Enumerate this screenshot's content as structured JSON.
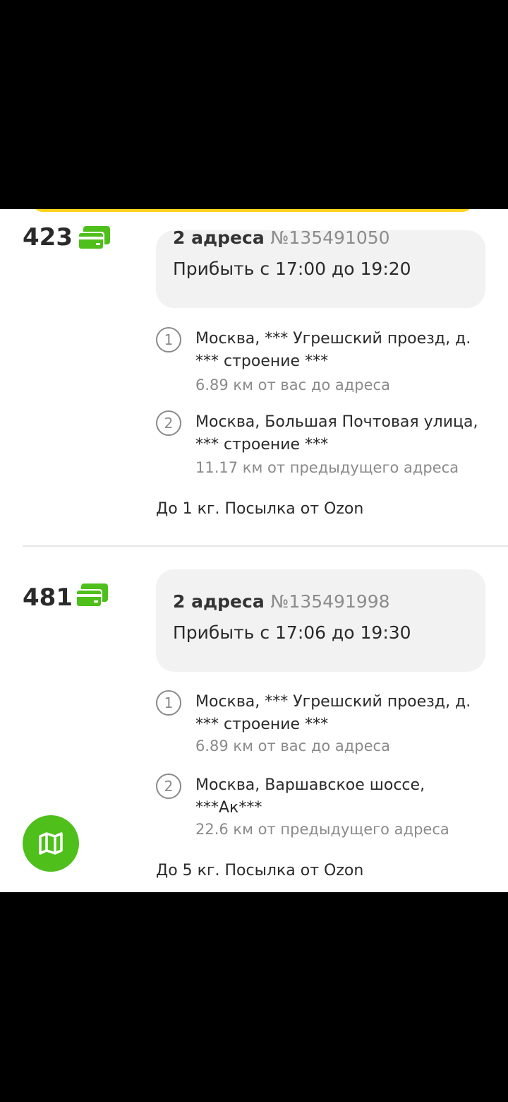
{
  "orders": [
    {
      "price": "423",
      "payment_icon": "card-icon",
      "title": "2 адреса",
      "number": "№135491050",
      "arrival": "Прибыть с 17:00 до 19:20",
      "addresses": [
        {
          "index": "1",
          "text": "Москва, *** Угрешский проезд, д. *** строение ***",
          "distance": "6.89 км от вас до адреса"
        },
        {
          "index": "2",
          "text": "Москва, Большая Почтовая улица, *** строение ***",
          "distance": "11.17 км от предыдущего адреса"
        }
      ],
      "parcel": "До 1 кг. Посылка от Ozon"
    },
    {
      "price": "481",
      "payment_icon": "card-icon",
      "title": "2 адреса",
      "number": "№135491998",
      "arrival": "Прибыть с 17:06 до 19:30",
      "addresses": [
        {
          "index": "1",
          "text": "Москва, *** Угрешский проезд, д. *** строение ***",
          "distance": "6.89 км от вас до адреса"
        },
        {
          "index": "2",
          "text": "Москва, Варшавское шоссе, ***Ак***",
          "distance": "22.6 км от предыдущего адреса"
        }
      ],
      "parcel": "До 5 кг. Посылка от Ozon"
    }
  ],
  "map_button": {
    "icon": "map-icon"
  },
  "colors": {
    "accent_green": "#4fbf1b",
    "banner_yellow": "#ffd21f"
  }
}
